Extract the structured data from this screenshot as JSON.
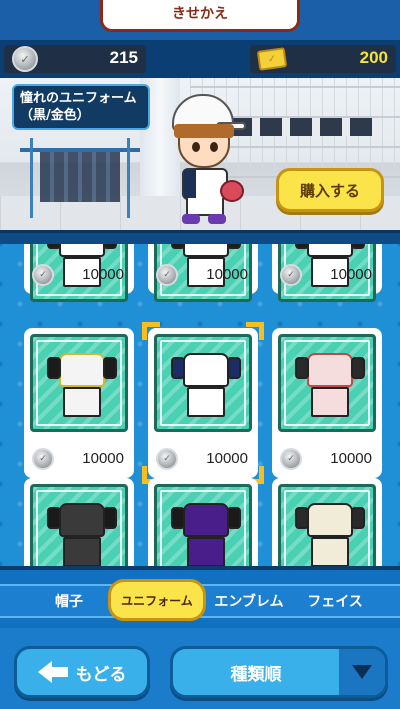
{
  "header": {
    "title": "きせかえ"
  },
  "currency": {
    "silver_coins": "215",
    "gold_tickets": "200"
  },
  "preview": {
    "item_name": "憧れのユニフォーム（黒/金色）",
    "buy_label": "購入する"
  },
  "items": [
    {
      "price": "10000",
      "colors": {
        "shirt": "#ffffff",
        "accent": "#1c1c1c"
      }
    },
    {
      "price": "10000",
      "colors": {
        "shirt": "#ffffff",
        "accent": "#1c1c1c"
      }
    },
    {
      "price": "10000",
      "colors": {
        "shirt": "#ffffff",
        "accent": "#1c1c1c"
      }
    },
    {
      "price": "10000",
      "colors": {
        "shirt": "#f4f4f4",
        "accent": "#1b1b1b",
        "trim": "#d9b62a"
      }
    },
    {
      "price": "10000",
      "colors": {
        "shirt": "#ffffff",
        "accent": "#1c2c66"
      },
      "selected": true
    },
    {
      "price": "10000",
      "colors": {
        "shirt": "#f6dddd",
        "accent": "#2a2a2a",
        "trim": "#c2484c"
      }
    },
    {
      "colors": {
        "shirt": "#3a3a3a",
        "accent": "#1a1a1a"
      }
    },
    {
      "colors": {
        "shirt": "#4a1e8a",
        "accent": "#1a1a1a"
      }
    },
    {
      "colors": {
        "shirt": "#f1ecd8",
        "accent": "#2a2a2a"
      }
    }
  ],
  "tabs": [
    {
      "label": "帽子",
      "active": false
    },
    {
      "label": "ユニフォーム",
      "active": true
    },
    {
      "label": "エンブレム",
      "active": false
    },
    {
      "label": "フェイス",
      "active": false
    }
  ],
  "bottom": {
    "back_label": "もどる",
    "sort_label": "種類順"
  },
  "colors": {
    "accent_yellow": "#fbe44a",
    "panel_blue": "#1f8fd6",
    "card_teal": "#4ad0b3",
    "title_brown": "#8a2b1a"
  }
}
